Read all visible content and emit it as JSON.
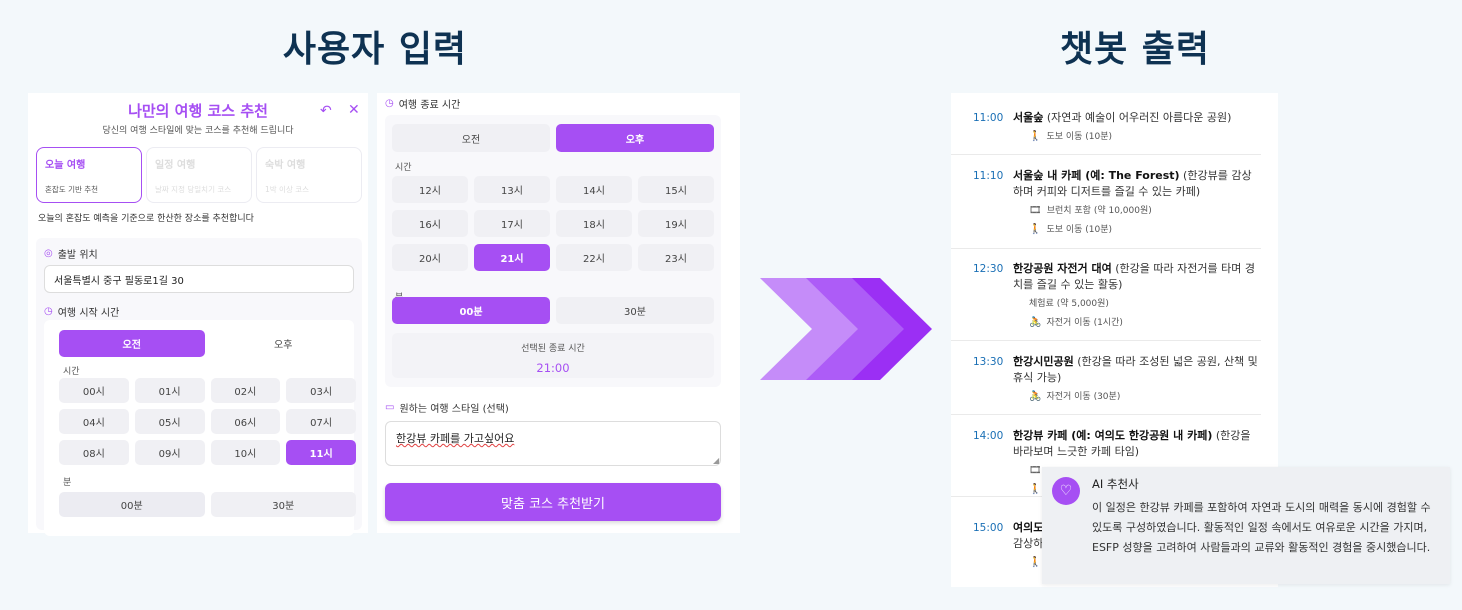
{
  "headings": {
    "input": "사용자 입력",
    "output": "챗봇 출력"
  },
  "form": {
    "title": "나만의 여행 코스 추천",
    "subtitle": "당신의 여행 스타일에 맞는 코스를 추천해 드립니다",
    "tabs": [
      {
        "title": "오늘 여행",
        "desc": "혼잡도 기반 추천"
      },
      {
        "title": "일정 여행",
        "desc": "날짜 지정 당일치기 코스"
      },
      {
        "title": "숙박 여행",
        "desc": "1박 이상 코스"
      }
    ],
    "description": "오늘의 혼잡도 예측을 기준으로 한산한 장소를 추천합니다",
    "start_location": {
      "label": "출발 위치",
      "value": "서울특별시 중구 필동로1길 30"
    },
    "start_time": {
      "label": "여행 시작 시간",
      "ampm": [
        "오전",
        "오후"
      ],
      "ampm_selected": "오전",
      "hour_label": "시간",
      "hours": [
        "00시",
        "01시",
        "02시",
        "03시",
        "04시",
        "05시",
        "06시",
        "07시",
        "08시",
        "09시",
        "10시",
        "11시"
      ],
      "hour_selected": "11시",
      "minute_label": "분",
      "minutes": [
        "00분",
        "30분"
      ],
      "minute_selected": "00분"
    },
    "end_time": {
      "label": "여행 종료 시간",
      "ampm": [
        "오전",
        "오후"
      ],
      "ampm_selected": "오후",
      "hour_label": "시간",
      "hours": [
        "12시",
        "13시",
        "14시",
        "15시",
        "16시",
        "17시",
        "18시",
        "19시",
        "20시",
        "21시",
        "22시",
        "23시"
      ],
      "hour_selected": "21시",
      "minute_label": "분",
      "minutes": [
        "00분",
        "30분"
      ],
      "minute_selected": "00분",
      "selected_label": "선택된 종료 시간",
      "selected_value": "21:00"
    },
    "style": {
      "label": "원하는 여행 스타일 (선택)",
      "value": "한강뷰 카페를 가고싶어요"
    },
    "submit": "맞춤 코스 추천받기"
  },
  "itinerary": [
    {
      "time": "11:00",
      "name": "서울숲",
      "detail": " (자연과 예술이 어우러진 아름다운 공원)",
      "subs": [
        {
          "icon": "walking-icon",
          "glyph": "🚶",
          "text": "도보 이동 (10분)"
        }
      ]
    },
    {
      "time": "11:10",
      "name": "서울숲 내 카페 (예: The Forest)",
      "detail": " (한강뷰를 감상하며 커피와 디저트를 즐길 수 있는 카페)",
      "subs": [
        {
          "icon": "ticket-icon",
          "glyph": "🎞",
          "text": "브런치 포함 (약 10,000원)"
        },
        {
          "icon": "walking-icon",
          "glyph": "🚶",
          "text": "도보 이동 (10분)"
        }
      ]
    },
    {
      "time": "12:30",
      "name": "한강공원 자전거 대여",
      "detail": " (한강을 따라 자전거를 타며 경치를 즐길 수 있는 활동)",
      "subs": [
        {
          "icon": "none",
          "glyph": "",
          "text": "체험료 (약 5,000원)"
        },
        {
          "icon": "bicycle-icon",
          "glyph": "🚴",
          "text": "자전거 이동 (1시간)"
        }
      ]
    },
    {
      "time": "13:30",
      "name": "한강시민공원",
      "detail": " (한강을 따라 조성된 넓은 공원, 산책 및 휴식 가능)",
      "subs": [
        {
          "icon": "bicycle-icon",
          "glyph": "🚴",
          "text": "자전거 이동 (30분)"
        }
      ]
    },
    {
      "time": "14:00",
      "name": "한강뷰 카페 (예: 여의도 한강공원 내 카페)",
      "detail": " (한강을 바라보며 느긋한 카페 타임)",
      "subs": [
        {
          "icon": "ticket-icon",
          "glyph": "🎞",
          "text": ""
        },
        {
          "icon": "walking-icon",
          "glyph": "🚶",
          "text": ""
        }
      ]
    },
    {
      "time": "15:00",
      "name": "여의도",
      "detail": "",
      "line2": "감상하",
      "subs": [
        {
          "icon": "walking-icon",
          "glyph": "🚶",
          "text": ""
        }
      ]
    }
  ],
  "recommender": {
    "title": "AI 추천사",
    "message": "이 일정은 한강뷰 카페를 포함하여 자연과 도시의 매력을 동시에 경험할 수 있도록 구성하였습니다. 활동적인 일정 속에서도 여유로운 시간을 가지며, ESFP 성향을 고려하여 사람들과의 교류와 활동적인 경험을 중시했습니다."
  },
  "colors": {
    "accent": "#a64ff3",
    "heading": "#0e3252",
    "time": "#1a6fb5"
  }
}
